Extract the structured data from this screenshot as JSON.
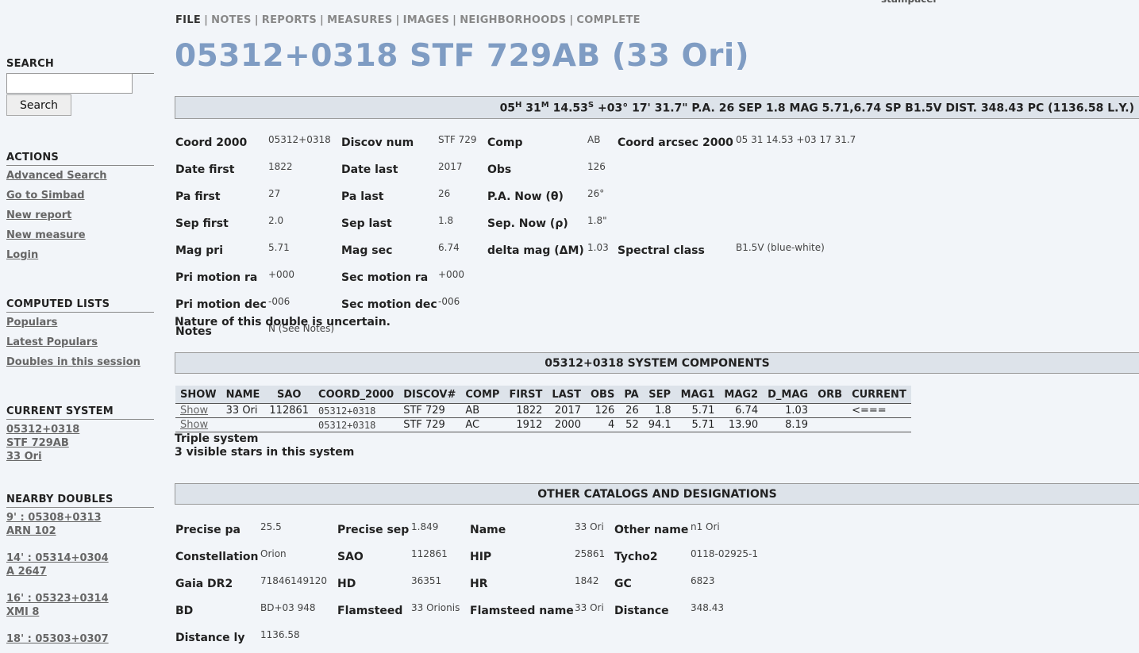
{
  "brand": "stampacer",
  "nav": {
    "items": [
      "FILE",
      "NOTES",
      "REPORTS",
      "MEASURES",
      "IMAGES",
      "NEIGHBORHOODS",
      "COMPLETE"
    ],
    "active": "FILE"
  },
  "title": "05312+0318 STF 729AB (33 Ori)",
  "summary": {
    "ra_h": "05",
    "h": "H",
    "ra_m": "31",
    "m": "M",
    "ra_s": "14.53",
    "s": "S",
    "rest": "+03° 17' 31.7\" P.A. 26 SEP 1.8 MAG 5.71,6.74 SP B1.5V DIST. 348.43 PC (1136.58 L.Y.)"
  },
  "sidebar": {
    "search": {
      "heading": "SEARCH",
      "value": "",
      "button": "Search"
    },
    "actions": {
      "heading": "ACTIONS",
      "items": [
        "Advanced Search",
        "Go to Simbad",
        "New report",
        "New measure",
        "Login"
      ]
    },
    "computed": {
      "heading": "COMPUTED LISTS",
      "items": [
        "Populars",
        "Latest Populars",
        "Doubles in this session"
      ]
    },
    "current": {
      "heading": "CURRENT SYSTEM",
      "items": [
        "05312+0318",
        "STF 729AB",
        "33 Ori"
      ]
    },
    "nearby": {
      "heading": "NEARBY DOUBLES",
      "items": [
        {
          "line1": "9' : 05308+0313",
          "line2": "ARN 102"
        },
        {
          "line1": "14' : 05314+0304",
          "line2": "A 2647"
        },
        {
          "line1": "16' : 05323+0314",
          "line2": "XMI 8"
        },
        {
          "line1": "18' : 05303+0307",
          "line2": ""
        }
      ]
    }
  },
  "details": {
    "coord2000_label": "Coord 2000",
    "coord2000": "05312+0318",
    "discov_label": "Discov num",
    "discov": "STF 729",
    "comp_label": "Comp",
    "comp": "AB",
    "arcsec_label": "Coord arcsec 2000",
    "arcsec": "05 31 14.53 +03 17 31.7",
    "date_first_label": "Date first",
    "date_first": "1822",
    "date_last_label": "Date last",
    "date_last": "2017",
    "obs_label": "Obs",
    "obs": "126",
    "pa_first_label": "Pa first",
    "pa_first": "27",
    "pa_last_label": "Pa last",
    "pa_last": "26",
    "pa_now_label": "P.A. Now (θ)",
    "pa_now": "26°",
    "sep_first_label": "Sep first",
    "sep_first": "2.0",
    "sep_last_label": "Sep last",
    "sep_last": "1.8",
    "sep_now_label": "Sep. Now (ρ)",
    "sep_now": "1.8\"",
    "mag_pri_label": "Mag pri",
    "mag_pri": "5.71",
    "mag_sec_label": "Mag sec",
    "mag_sec": "6.74",
    "delta_label": "delta mag (ΔM)",
    "delta": "1.03",
    "spectral_label": "Spectral class",
    "spectral": "B1.5V (blue-white)",
    "pri_ra_label": "Pri motion ra",
    "pri_ra": "+000",
    "sec_ra_label": "Sec motion ra",
    "sec_ra": "+000",
    "pri_dec_label": "Pri motion dec",
    "pri_dec": "-006",
    "sec_dec_label": "Sec motion dec",
    "sec_dec": "-006",
    "notes_label": "Notes",
    "notes": "N (See Notes)"
  },
  "nature": "Nature of this double is uncertain.",
  "components": {
    "heading": "05312+0318 SYSTEM COMPONENTS",
    "columns": [
      "SHOW",
      "NAME",
      "SAO",
      "COORD_2000",
      "DISCOV#",
      "COMP",
      "FIRST",
      "LAST",
      "OBS",
      "PA",
      "SEP",
      "MAG1",
      "MAG2",
      "D_MAG",
      "ORB",
      "CURRENT"
    ],
    "rows": [
      [
        "Show",
        "33 Ori",
        "112861",
        "05312+0318",
        "STF 729",
        "AB",
        "1822",
        "2017",
        "126",
        "26",
        "1.8",
        "5.71",
        "6.74",
        "1.03",
        "",
        "<==="
      ],
      [
        "Show",
        "",
        "",
        "05312+0318",
        "STF 729",
        "AC",
        "1912",
        "2000",
        "4",
        "52",
        "94.1",
        "5.71",
        "13.90",
        "8.19",
        "",
        ""
      ]
    ],
    "note1": "Triple system",
    "note2": "3 visible stars in this system"
  },
  "catalogs": {
    "heading": "OTHER CATALOGS AND DESIGNATIONS",
    "precise_pa_label": "Precise pa",
    "precise_pa": "25.5",
    "precise_sep_label": "Precise sep",
    "precise_sep": "1.849",
    "name_label": "Name",
    "name": "33 Ori",
    "other_label": "Other name",
    "other": "n1 Ori",
    "const_label": "Constellation",
    "const": "Orion",
    "sao_label": "SAO",
    "sao": "112861",
    "hip_label": "HIP",
    "hip": "25861",
    "tycho_label": "Tycho2",
    "tycho": "0118-02925-1",
    "gaia_label": "Gaia DR2",
    "gaia": "71846149120",
    "hd_label": "HD",
    "hd": "36351",
    "hr_label": "HR",
    "hr": "1842",
    "gc_label": "GC",
    "gc": "6823",
    "bd_label": "BD",
    "bd": "BD+03 948",
    "flam_label": "Flamsteed",
    "flam": "33 Orionis",
    "flamname_label": "Flamsteed name",
    "flamname": "33 Ori",
    "dist_label": "Distance",
    "dist": "348.43",
    "distly_label": "Distance ly",
    "distly": "1136.58"
  }
}
